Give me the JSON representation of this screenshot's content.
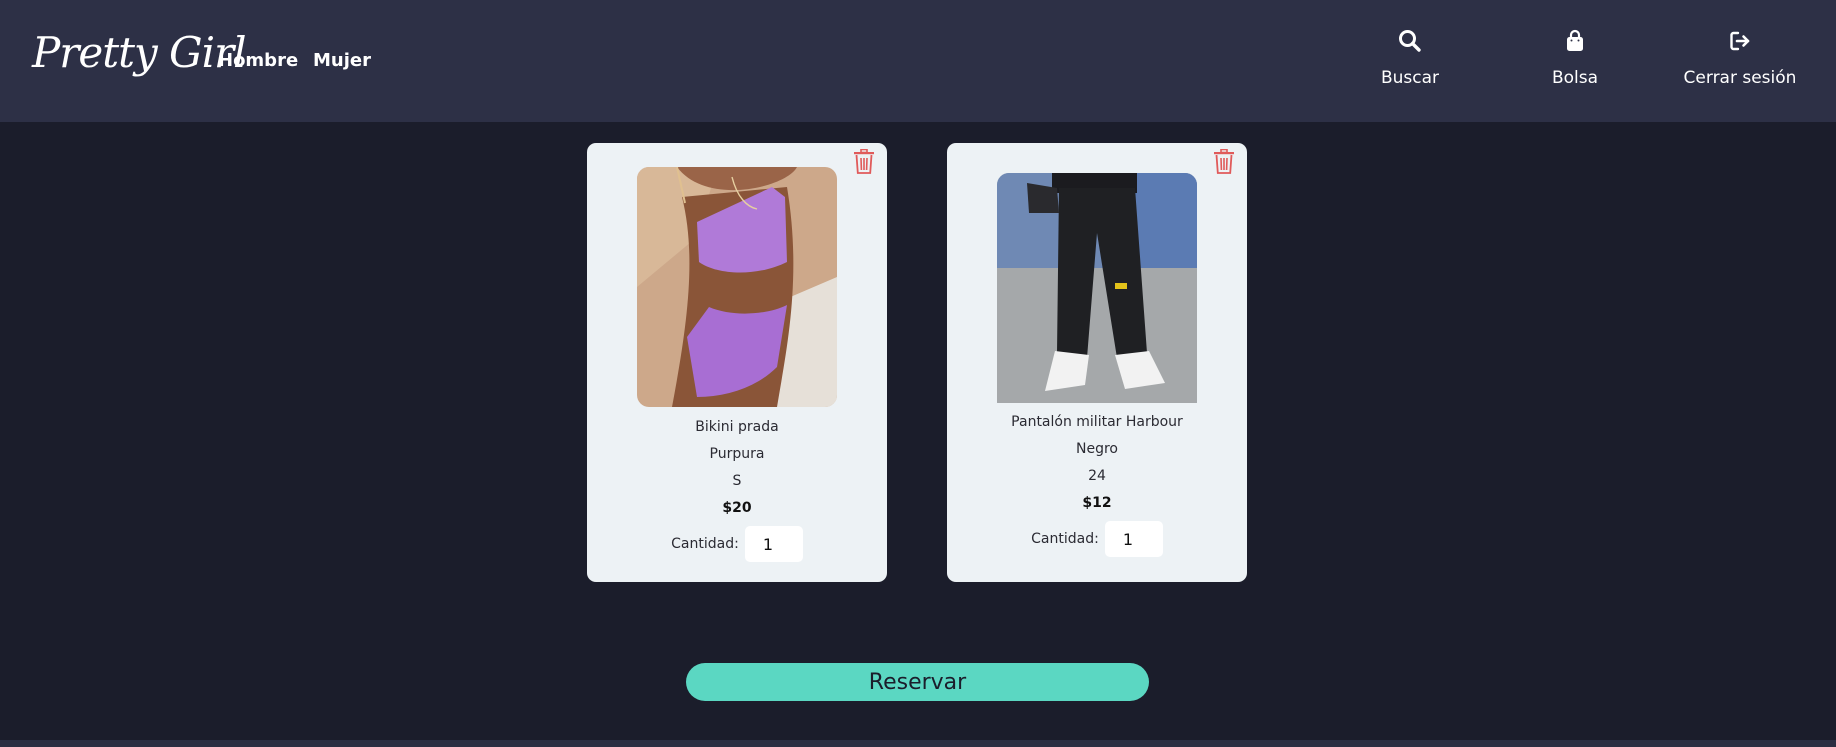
{
  "brand": {
    "logo_text": "Pretty Girl"
  },
  "nav": {
    "links": [
      {
        "label": "Hombre"
      },
      {
        "label": "Mujer"
      }
    ],
    "actions": [
      {
        "label": "Buscar",
        "icon": "search-icon"
      },
      {
        "label": "Bolsa",
        "icon": "shopping-bag-icon"
      },
      {
        "label": "Cerrar sesión",
        "icon": "logout-icon"
      }
    ]
  },
  "cart": {
    "items": [
      {
        "name": "Bikini prada",
        "color": "Purpura",
        "size": "S",
        "price": "$20",
        "quantity_label": "Cantidad:",
        "quantity": "1"
      },
      {
        "name": "Pantalón militar Harbour",
        "color": "Negro",
        "size": "24",
        "price": "$12",
        "quantity_label": "Cantidad:",
        "quantity": "1"
      }
    ],
    "reserve_label": "Reservar"
  },
  "theme": {
    "background": "#1b1d2b",
    "navbar": "#2d3046",
    "card": "#edf2f5",
    "accent": "#5bd7c2",
    "delete": "#e05a5a"
  }
}
